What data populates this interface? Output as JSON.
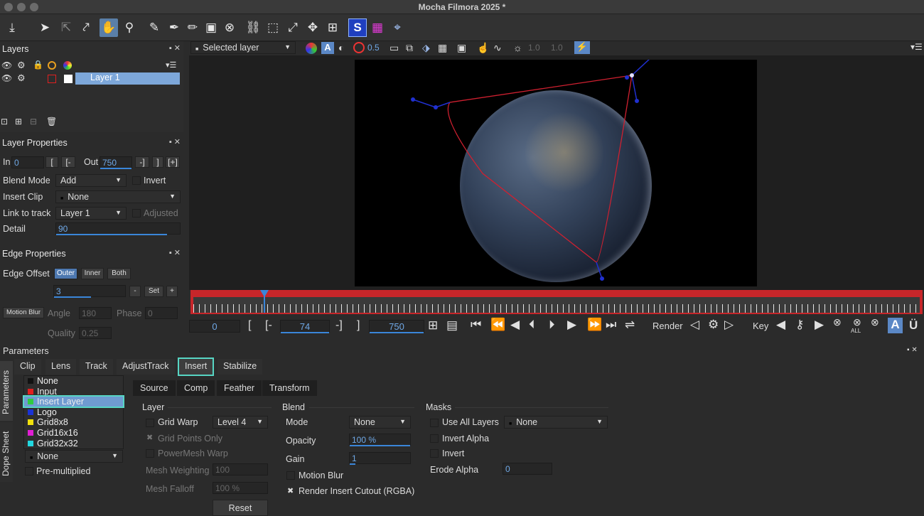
{
  "window": {
    "title": "Mocha Filmora 2025 *"
  },
  "toolbar": {
    "layer_select": "Selected layer",
    "opacity_value": "0.5",
    "val_a": "1.0",
    "val_b": "1.0"
  },
  "layers_panel": {
    "title": "Layers",
    "layer_name": "Layer 1"
  },
  "layer_props": {
    "title": "Layer Properties",
    "in_label": "In",
    "in_value": "0",
    "out_label": "Out",
    "out_value": "750",
    "bracket_a": "[",
    "bracket_b": "[-",
    "bracket_c": "-]",
    "bracket_d": "]",
    "bracket_e": "[+]",
    "blend_mode_label": "Blend Mode",
    "blend_mode_value": "Add",
    "invert_label": "Invert",
    "insert_clip_label": "Insert Clip",
    "insert_clip_value": "None",
    "link_label": "Link to track",
    "link_value": "Layer 1",
    "adjusted_label": "Adjusted",
    "detail_label": "Detail",
    "detail_value": "90"
  },
  "edge_props": {
    "title": "Edge Properties",
    "offset_label": "Edge Offset",
    "outer": "Outer",
    "inner": "Inner",
    "both": "Both",
    "offset_value": "3",
    "minus": "-",
    "set": "Set",
    "plus": "+",
    "motion_blur": "Motion Blur",
    "angle_label": "Angle",
    "angle_value": "180",
    "phase_label": "Phase",
    "phase_value": "0",
    "quality_label": "Quality",
    "quality_value": "0.25"
  },
  "timeline": {
    "start": "0",
    "mid": "74",
    "end": "750",
    "render": "Render",
    "key": "Key",
    "all": "ALL",
    "open_bracket": "[",
    "open_dash": "[-",
    "close_dash": "-]",
    "close_bracket": "]"
  },
  "parameters": {
    "title": "Parameters",
    "side_tab_params": "Parameters",
    "side_tab_dope": "Dope Sheet",
    "tabs": [
      "Clip",
      "Lens",
      "Track",
      "AdjustTrack",
      "Insert",
      "Stabilize"
    ],
    "subtabs": [
      "Source",
      "Comp",
      "Feather",
      "Transform"
    ],
    "dropdown_items": [
      {
        "label": "None",
        "color": "#111111"
      },
      {
        "label": "Input",
        "color": "#e02020"
      },
      {
        "label": "Insert Layer",
        "color": "#2ecc40"
      },
      {
        "label": "Logo",
        "color": "#1a33d6"
      },
      {
        "label": "Grid8x8",
        "color": "#f2e10c"
      },
      {
        "label": "Grid16x16",
        "color": "#e21ed4"
      },
      {
        "label": "Grid32x32",
        "color": "#22d8e0"
      }
    ],
    "clip_none": "None",
    "premultiplied": "Pre-multiplied",
    "layer_section": "Layer",
    "grid_warp": "Grid Warp",
    "grid_warp_value": "Level 4",
    "grid_points_only": "Grid Points Only",
    "powermesh_warp": "PowerMesh Warp",
    "mesh_weighting": "Mesh Weighting",
    "mesh_weighting_value": "100",
    "mesh_falloff": "Mesh Falloff",
    "mesh_falloff_value": "100 %",
    "reset": "Reset",
    "blend_section": "Blend",
    "mode": "Mode",
    "mode_value": "None",
    "opacity": "Opacity",
    "opacity_value": "100 %",
    "gain": "Gain",
    "gain_value": "1",
    "motion_blur": "Motion Blur",
    "render_insert": "Render Insert Cutout (RGBA)",
    "masks_section": "Masks",
    "use_all_layers": "Use All Layers",
    "use_all_layers_value": "None",
    "invert_alpha": "Invert Alpha",
    "invert": "Invert",
    "erode_alpha": "Erode Alpha",
    "erode_alpha_value": "0"
  }
}
